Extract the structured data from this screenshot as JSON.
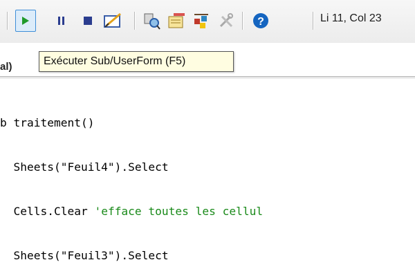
{
  "toolbar": {
    "buttons": [
      {
        "name": "run-sub-button",
        "icon": "play-icon",
        "active": true
      },
      {
        "name": "break-button",
        "icon": "pause-icon"
      },
      {
        "name": "reset-button",
        "icon": "stop-icon"
      },
      {
        "name": "design-mode-button",
        "icon": "design-mode-icon"
      },
      {
        "name": "project-explorer-button",
        "icon": "project-explorer-icon"
      },
      {
        "name": "properties-window-button",
        "icon": "properties-icon"
      },
      {
        "name": "object-browser-button",
        "icon": "object-browser-icon"
      },
      {
        "name": "toolbox-button",
        "icon": "toolbox-icon"
      },
      {
        "name": "help-button",
        "icon": "help-icon"
      }
    ],
    "position_status": "Li 11, Col 23"
  },
  "tooltip": {
    "text": "Exécuter Sub/UserForm (F5)"
  },
  "combo": {
    "visible_text": "al)"
  },
  "code": {
    "line1": "b traitement()",
    "line2": "  Sheets(\"Feuil4\").Select",
    "line3_code": "  Cells.Clear ",
    "line3_comment": "'efface toutes les cellul",
    "line4": "  Sheets(\"Feuil3\").Select"
  },
  "colors": {
    "accent": "#3e8ed8",
    "play": "#1f9a2a",
    "comment": "#1a8a1a",
    "help": "#1565c0"
  }
}
